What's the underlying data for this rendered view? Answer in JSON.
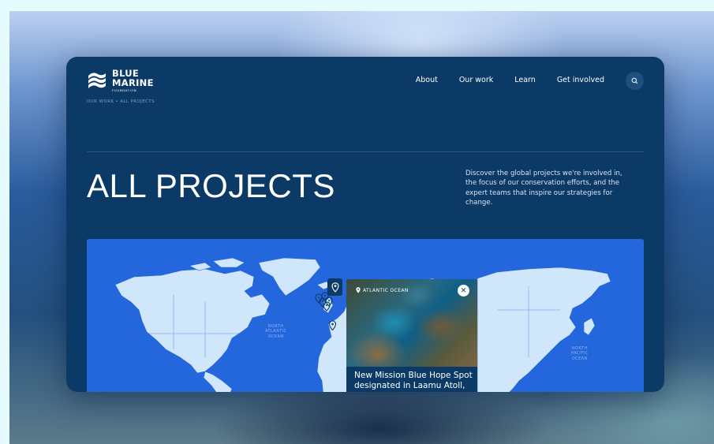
{
  "brand": {
    "line1": "BLUE",
    "line2": "MARINE",
    "line3": "FOUNDATION"
  },
  "breadcrumb": "OUR WORK  •  ALL PROJECTS",
  "nav": {
    "items": [
      {
        "label": "About"
      },
      {
        "label": "Our work"
      },
      {
        "label": "Learn"
      },
      {
        "label": "Get involved"
      }
    ],
    "search_icon": "search-icon"
  },
  "page": {
    "title": "ALL PROJECTS",
    "intro": "Discover the global projects we're involved in, the focus of our conservation efforts, and the expert teams that inspire our strategies for change."
  },
  "map": {
    "ocean_labels": {
      "north_atlantic": "NORTH\nATLANTIC\nOCEAN",
      "north_pacific": "NORTH\nPACIFIC\nOCEAN"
    },
    "popup": {
      "location": "ATLANTIC OCEAN",
      "title": "New Mission Blue Hope Spot designated in Laamu Atoll,",
      "close_icon": "close-icon"
    }
  },
  "colors": {
    "window": "#0b3a66",
    "map_ocean": "#2466db",
    "map_land": "#cfe6fb"
  }
}
